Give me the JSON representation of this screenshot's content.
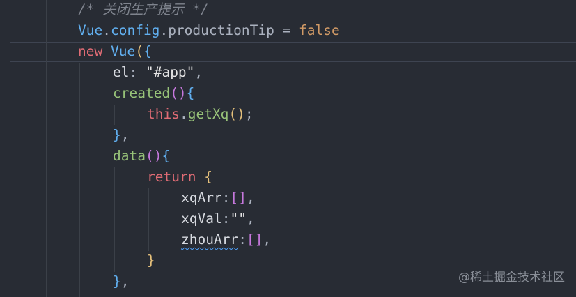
{
  "editor": {
    "lines": [
      {
        "tokens": [
          {
            "text": "/* 关闭生产提示 */",
            "cls": "c-comment"
          }
        ]
      },
      {
        "tokens": [
          {
            "text": "Vue",
            "cls": "c-class"
          },
          {
            "text": ".",
            "cls": "c-plain"
          },
          {
            "text": "config",
            "cls": "c-class"
          },
          {
            "text": ".",
            "cls": "c-plain"
          },
          {
            "text": "productionTip",
            "cls": "c-prop"
          },
          {
            "text": " = ",
            "cls": "c-plain"
          },
          {
            "text": "false",
            "cls": "c-kw-bool"
          }
        ]
      },
      {
        "tokens": [
          {
            "text": "new",
            "cls": "c-kw"
          },
          {
            "text": " ",
            "cls": "c-plain"
          },
          {
            "text": "Vue",
            "cls": "c-class"
          },
          {
            "text": "(",
            "cls": "c-brace-y"
          },
          {
            "text": "{",
            "cls": "c-brace-b"
          }
        ]
      },
      {
        "tokens": [
          {
            "text": "el",
            "cls": "c-ident"
          },
          {
            "text": ": ",
            "cls": "c-plain"
          },
          {
            "text": "\"#app\"",
            "cls": "c-string"
          },
          {
            "text": ",",
            "cls": "c-plain"
          }
        ]
      },
      {
        "tokens": [
          {
            "text": "created",
            "cls": "c-fn"
          },
          {
            "text": "()",
            "cls": "c-brace-m"
          },
          {
            "text": "{",
            "cls": "c-brace-b"
          }
        ]
      },
      {
        "tokens": [
          {
            "text": "this",
            "cls": "c-this"
          },
          {
            "text": ".",
            "cls": "c-plain"
          },
          {
            "text": "getXq",
            "cls": "c-fn"
          },
          {
            "text": "()",
            "cls": "c-brace-y"
          },
          {
            "text": ";",
            "cls": "c-plain"
          }
        ]
      },
      {
        "tokens": [
          {
            "text": "}",
            "cls": "c-brace-b"
          },
          {
            "text": ",",
            "cls": "c-plain"
          }
        ]
      },
      {
        "tokens": [
          {
            "text": "data",
            "cls": "c-fn"
          },
          {
            "text": "()",
            "cls": "c-brace-m"
          },
          {
            "text": "{",
            "cls": "c-brace-b"
          }
        ]
      },
      {
        "tokens": [
          {
            "text": "return",
            "cls": "c-kw"
          },
          {
            "text": " ",
            "cls": "c-plain"
          },
          {
            "text": "{",
            "cls": "c-brace-y"
          }
        ]
      },
      {
        "tokens": [
          {
            "text": "xqArr",
            "cls": "c-ident"
          },
          {
            "text": ":",
            "cls": "c-plain"
          },
          {
            "text": "[]",
            "cls": "c-brace-m"
          },
          {
            "text": ",",
            "cls": "c-plain"
          }
        ]
      },
      {
        "tokens": [
          {
            "text": "xqVal",
            "cls": "c-ident"
          },
          {
            "text": ":",
            "cls": "c-plain"
          },
          {
            "text": "\"\"",
            "cls": "c-string"
          },
          {
            "text": ",",
            "cls": "c-plain"
          }
        ]
      },
      {
        "tokens": [
          {
            "text": "zhouArr",
            "cls": "c-ident squiggle"
          },
          {
            "text": ":",
            "cls": "c-plain"
          },
          {
            "text": "[]",
            "cls": "c-brace-m"
          },
          {
            "text": ",",
            "cls": "c-plain"
          }
        ]
      },
      {
        "tokens": [
          {
            "text": "}",
            "cls": "c-brace-y"
          }
        ]
      },
      {
        "tokens": [
          {
            "text": "}",
            "cls": "c-brace-b"
          },
          {
            "text": ",",
            "cls": "c-plain"
          }
        ]
      }
    ]
  },
  "watermark": "@稀土掘金技术社区"
}
